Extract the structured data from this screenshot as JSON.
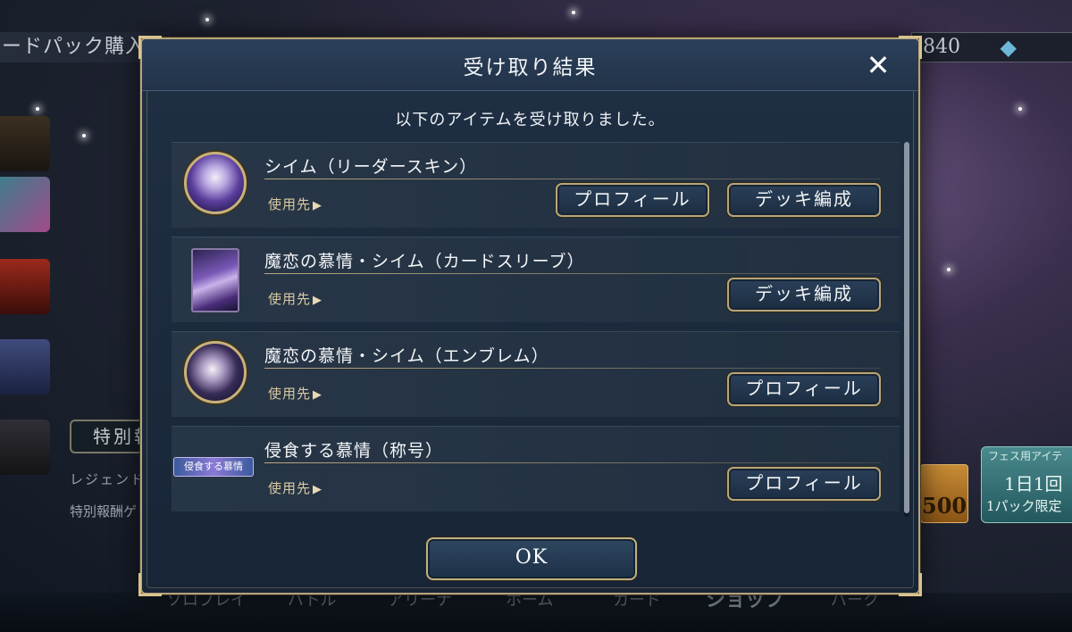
{
  "background": {
    "top_title": "ードパック購入",
    "currency_amount": "840",
    "special_reward_label": "特別報酬",
    "legend_text": "レジェンド確定",
    "special_desc": "特別報酬ゲット",
    "price": "500",
    "fes_label": "フェス用アイテ",
    "fes_daily": "1日1回",
    "fes_limit": "1パック限定",
    "nav": [
      "ソロプレイ",
      "バトル",
      "アリーナ",
      "ホーム",
      "カード",
      "ショップ",
      "パーク"
    ]
  },
  "dialog": {
    "title": "受け取り結果",
    "close_label": "✕",
    "subtitle": "以下のアイテムを受け取りました。",
    "ok_label": "OK",
    "usage_label": "使用先",
    "items": [
      {
        "name": "シイム（リーダースキン）",
        "buttons": [
          "プロフィール",
          "デッキ編成"
        ]
      },
      {
        "name": "魔恋の慕情・シイム（カードスリーブ）",
        "buttons": [
          "デッキ編成"
        ]
      },
      {
        "name": "魔恋の慕情・シイム（エンブレム）",
        "buttons": [
          "プロフィール"
        ]
      },
      {
        "name": "侵食する慕情（称号）",
        "badge_text": "侵食する慕情",
        "buttons": [
          "プロフィール"
        ]
      }
    ]
  },
  "colors": {
    "dialog_bg": "#1b2a3c",
    "gold_border": "#b6a47a",
    "usage_text": "#d9c9a0"
  }
}
